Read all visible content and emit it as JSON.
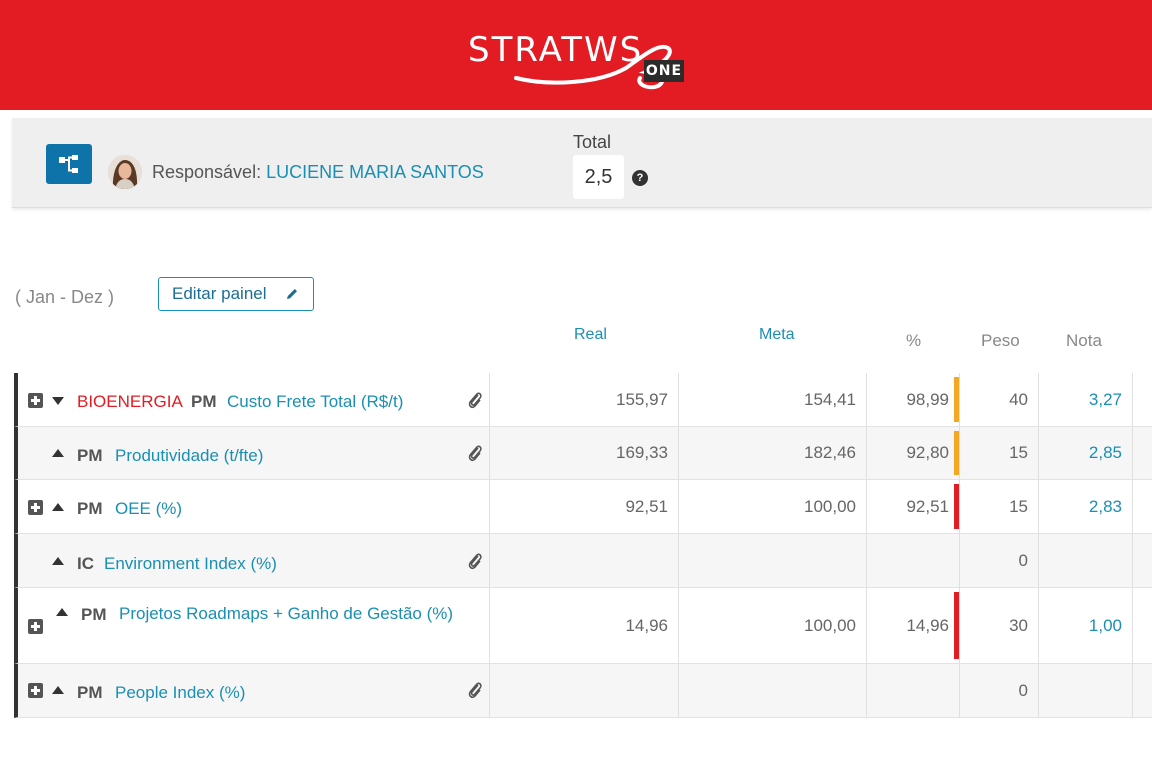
{
  "header": {
    "logo_text": "STRATWS",
    "logo_badge": "ONE",
    "brand_color": "#e31b23"
  },
  "responsible": {
    "icon": "org-tree-icon",
    "label": "Responsável:",
    "name": "LUCIENE MARIA SANTOS",
    "total_label": "Total",
    "total_value": "2,5",
    "help_icon": "question-circle-icon",
    "help_glyph": "?"
  },
  "period": "( Jan - Dez )",
  "edit_button": {
    "label": "Editar painel",
    "icon": "pencil-icon"
  },
  "columns": {
    "real": "Real",
    "meta": "Meta",
    "pct": "%",
    "peso": "Peso",
    "nota": "Nota"
  },
  "status_colors": {
    "orange": "#f5a623",
    "red": "#e31b23"
  },
  "rows": [
    {
      "expander": true,
      "arrow": "down",
      "dept": "BIOENERGIA",
      "type": "PM",
      "name": "Custo Frete Total (R$/t)",
      "clip": true,
      "real": "155,97",
      "meta": "154,41",
      "pct": "98,99",
      "status": "orange",
      "peso": "40",
      "nota": "3,27"
    },
    {
      "expander": false,
      "arrow": "up",
      "dept": "",
      "type": "PM",
      "name": "Produtividade (t/fte)",
      "clip": true,
      "real": "169,33",
      "meta": "182,46",
      "pct": "92,80",
      "status": "orange",
      "peso": "15",
      "nota": "2,85"
    },
    {
      "expander": true,
      "arrow": "up",
      "dept": "",
      "type": "PM",
      "name": "OEE (%)",
      "clip": false,
      "real": "92,51",
      "meta": "100,00",
      "pct": "92,51",
      "status": "red",
      "peso": "15",
      "nota": "2,83"
    },
    {
      "expander": false,
      "arrow": "up",
      "dept": "",
      "type": "IC",
      "name": "Environment Index (%)",
      "clip": true,
      "real": "",
      "meta": "",
      "pct": "",
      "status": "",
      "peso": "0",
      "nota": ""
    },
    {
      "expander": true,
      "arrow": "up",
      "dept": "",
      "type": "PM",
      "name": "Projetos Roadmaps + Ganho de Gestão (%)",
      "clip": false,
      "real": "14,96",
      "meta": "100,00",
      "pct": "14,96",
      "status": "red",
      "peso": "30",
      "nota": "1,00"
    },
    {
      "expander": true,
      "arrow": "up",
      "dept": "",
      "type": "PM",
      "name": "People Index (%)",
      "clip": true,
      "real": "",
      "meta": "",
      "pct": "",
      "status": "",
      "peso": "0",
      "nota": ""
    }
  ]
}
